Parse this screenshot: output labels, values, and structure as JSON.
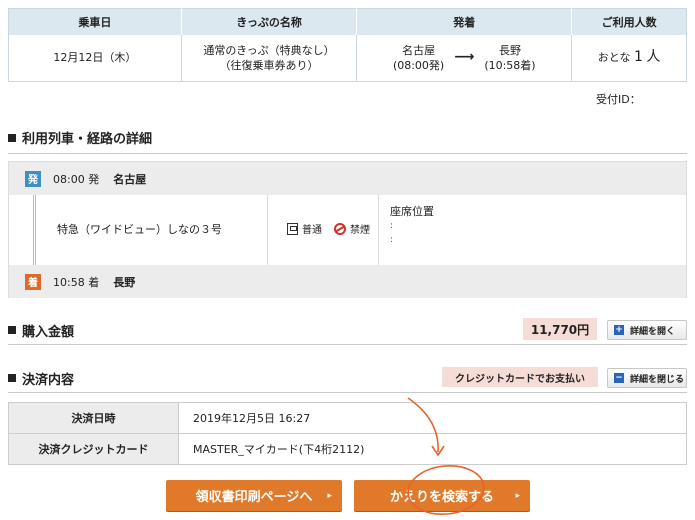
{
  "summary": {
    "headers": [
      "乗車日",
      "きっぷの名称",
      "発着",
      "ご利用人数"
    ],
    "date": "12月12日（木）",
    "ticket_line1": "通常のきっぷ（特典なし）",
    "ticket_line2": "（往復乗車券あり）",
    "from_station": "名古屋",
    "from_time": "(08:00発)",
    "to_station": "長野",
    "to_time": "(10:58着)",
    "people_prefix": "おとな",
    "people_count": "1",
    "people_suffix": "人"
  },
  "receipt_label": "受付ID：",
  "route_section": {
    "title": "利用列車・経路の詳細",
    "dep_badge": "発",
    "dep_time": "08:00 発",
    "dep_station": "名古屋",
    "train_name": "特急（ワイドビュー）しなの３号",
    "car_type": "普通",
    "smoking": "禁煙",
    "seat_label": "座席位置",
    "seat_dot1": ":",
    "seat_dot2": ":",
    "arr_badge": "着",
    "arr_time": "10:58 着",
    "arr_station": "長野"
  },
  "price_section": {
    "title": "購入金額",
    "amount": "11,770円",
    "open_button": "詳細を開く",
    "open_icon": "+"
  },
  "payment_section": {
    "title": "決済内容",
    "method_badge": "クレジットカードでお支払い",
    "close_button": "詳細を閉じる",
    "close_icon": "−",
    "rows": [
      {
        "label": "決済日時",
        "value": "2019年12月5日 16:27"
      },
      {
        "label": "決済クレジットカード",
        "value": "MASTER_マイカード(下4桁2112)"
      }
    ]
  },
  "buttons": {
    "print_receipt": "領収書印刷ページへ",
    "search_return": "かえりを検索する",
    "chevron": "▸"
  },
  "colors": {
    "accent": "#e07a2a",
    "annotation": "#e8622a"
  }
}
